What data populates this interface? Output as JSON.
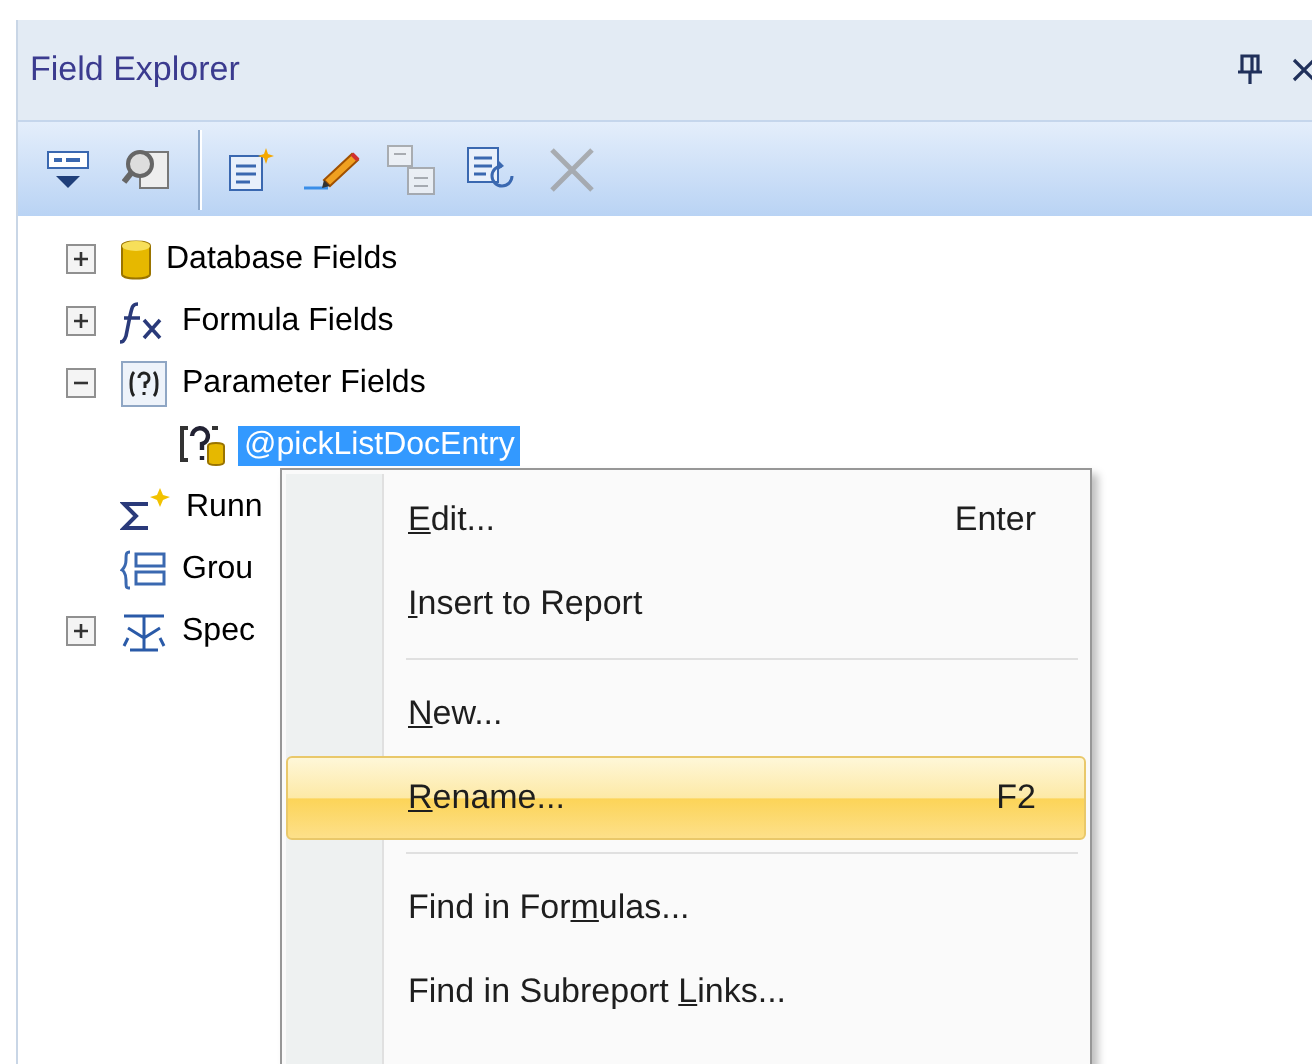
{
  "panel": {
    "title": "Field Explorer"
  },
  "toolbar": [
    {
      "kind": "insert",
      "disabled": false
    },
    {
      "kind": "browse",
      "disabled": false
    },
    {
      "kind": "new",
      "disabled": false
    },
    {
      "kind": "edit",
      "disabled": false
    },
    {
      "kind": "duplicate",
      "disabled": true
    },
    {
      "kind": "rename",
      "disabled": false
    },
    {
      "kind": "delete",
      "disabled": true
    }
  ],
  "tree": [
    {
      "kind": "database",
      "label": "Database Fields",
      "expanded": false,
      "selected": false
    },
    {
      "kind": "formula",
      "label": "Formula Fields",
      "expanded": false,
      "selected": false
    },
    {
      "kind": "parameter",
      "label": "Parameter Fields",
      "expanded": true,
      "selected": false,
      "children": [
        {
          "kind": "param-item",
          "label": "@pickListDocEntry",
          "selected": true
        }
      ]
    },
    {
      "kind": "running",
      "label": "Runn",
      "selected": false
    },
    {
      "kind": "group",
      "label": "Grou",
      "selected": false
    },
    {
      "kind": "special",
      "label": "Spec",
      "expanded": false,
      "selected": false
    }
  ],
  "context_menu": [
    {
      "kind": "item",
      "access_key": "E",
      "label_after": "dit...",
      "shortcut": "Enter",
      "selected": false
    },
    {
      "kind": "item",
      "access_key": "I",
      "label_after": "nsert to Report",
      "selected": false
    },
    {
      "kind": "separator"
    },
    {
      "kind": "item",
      "access_key": "N",
      "label_after": "ew...",
      "selected": false
    },
    {
      "kind": "item",
      "access_key": "R",
      "label_after": "ename...",
      "shortcut": "F2",
      "selected": true
    },
    {
      "kind": "separator"
    },
    {
      "kind": "item",
      "label_before": "Find in For",
      "access_key": "m",
      "label_after": "ulas...",
      "selected": false
    },
    {
      "kind": "item",
      "label_before": "Find in Subreport ",
      "access_key": "L",
      "label_after": "inks...",
      "selected": false
    }
  ]
}
